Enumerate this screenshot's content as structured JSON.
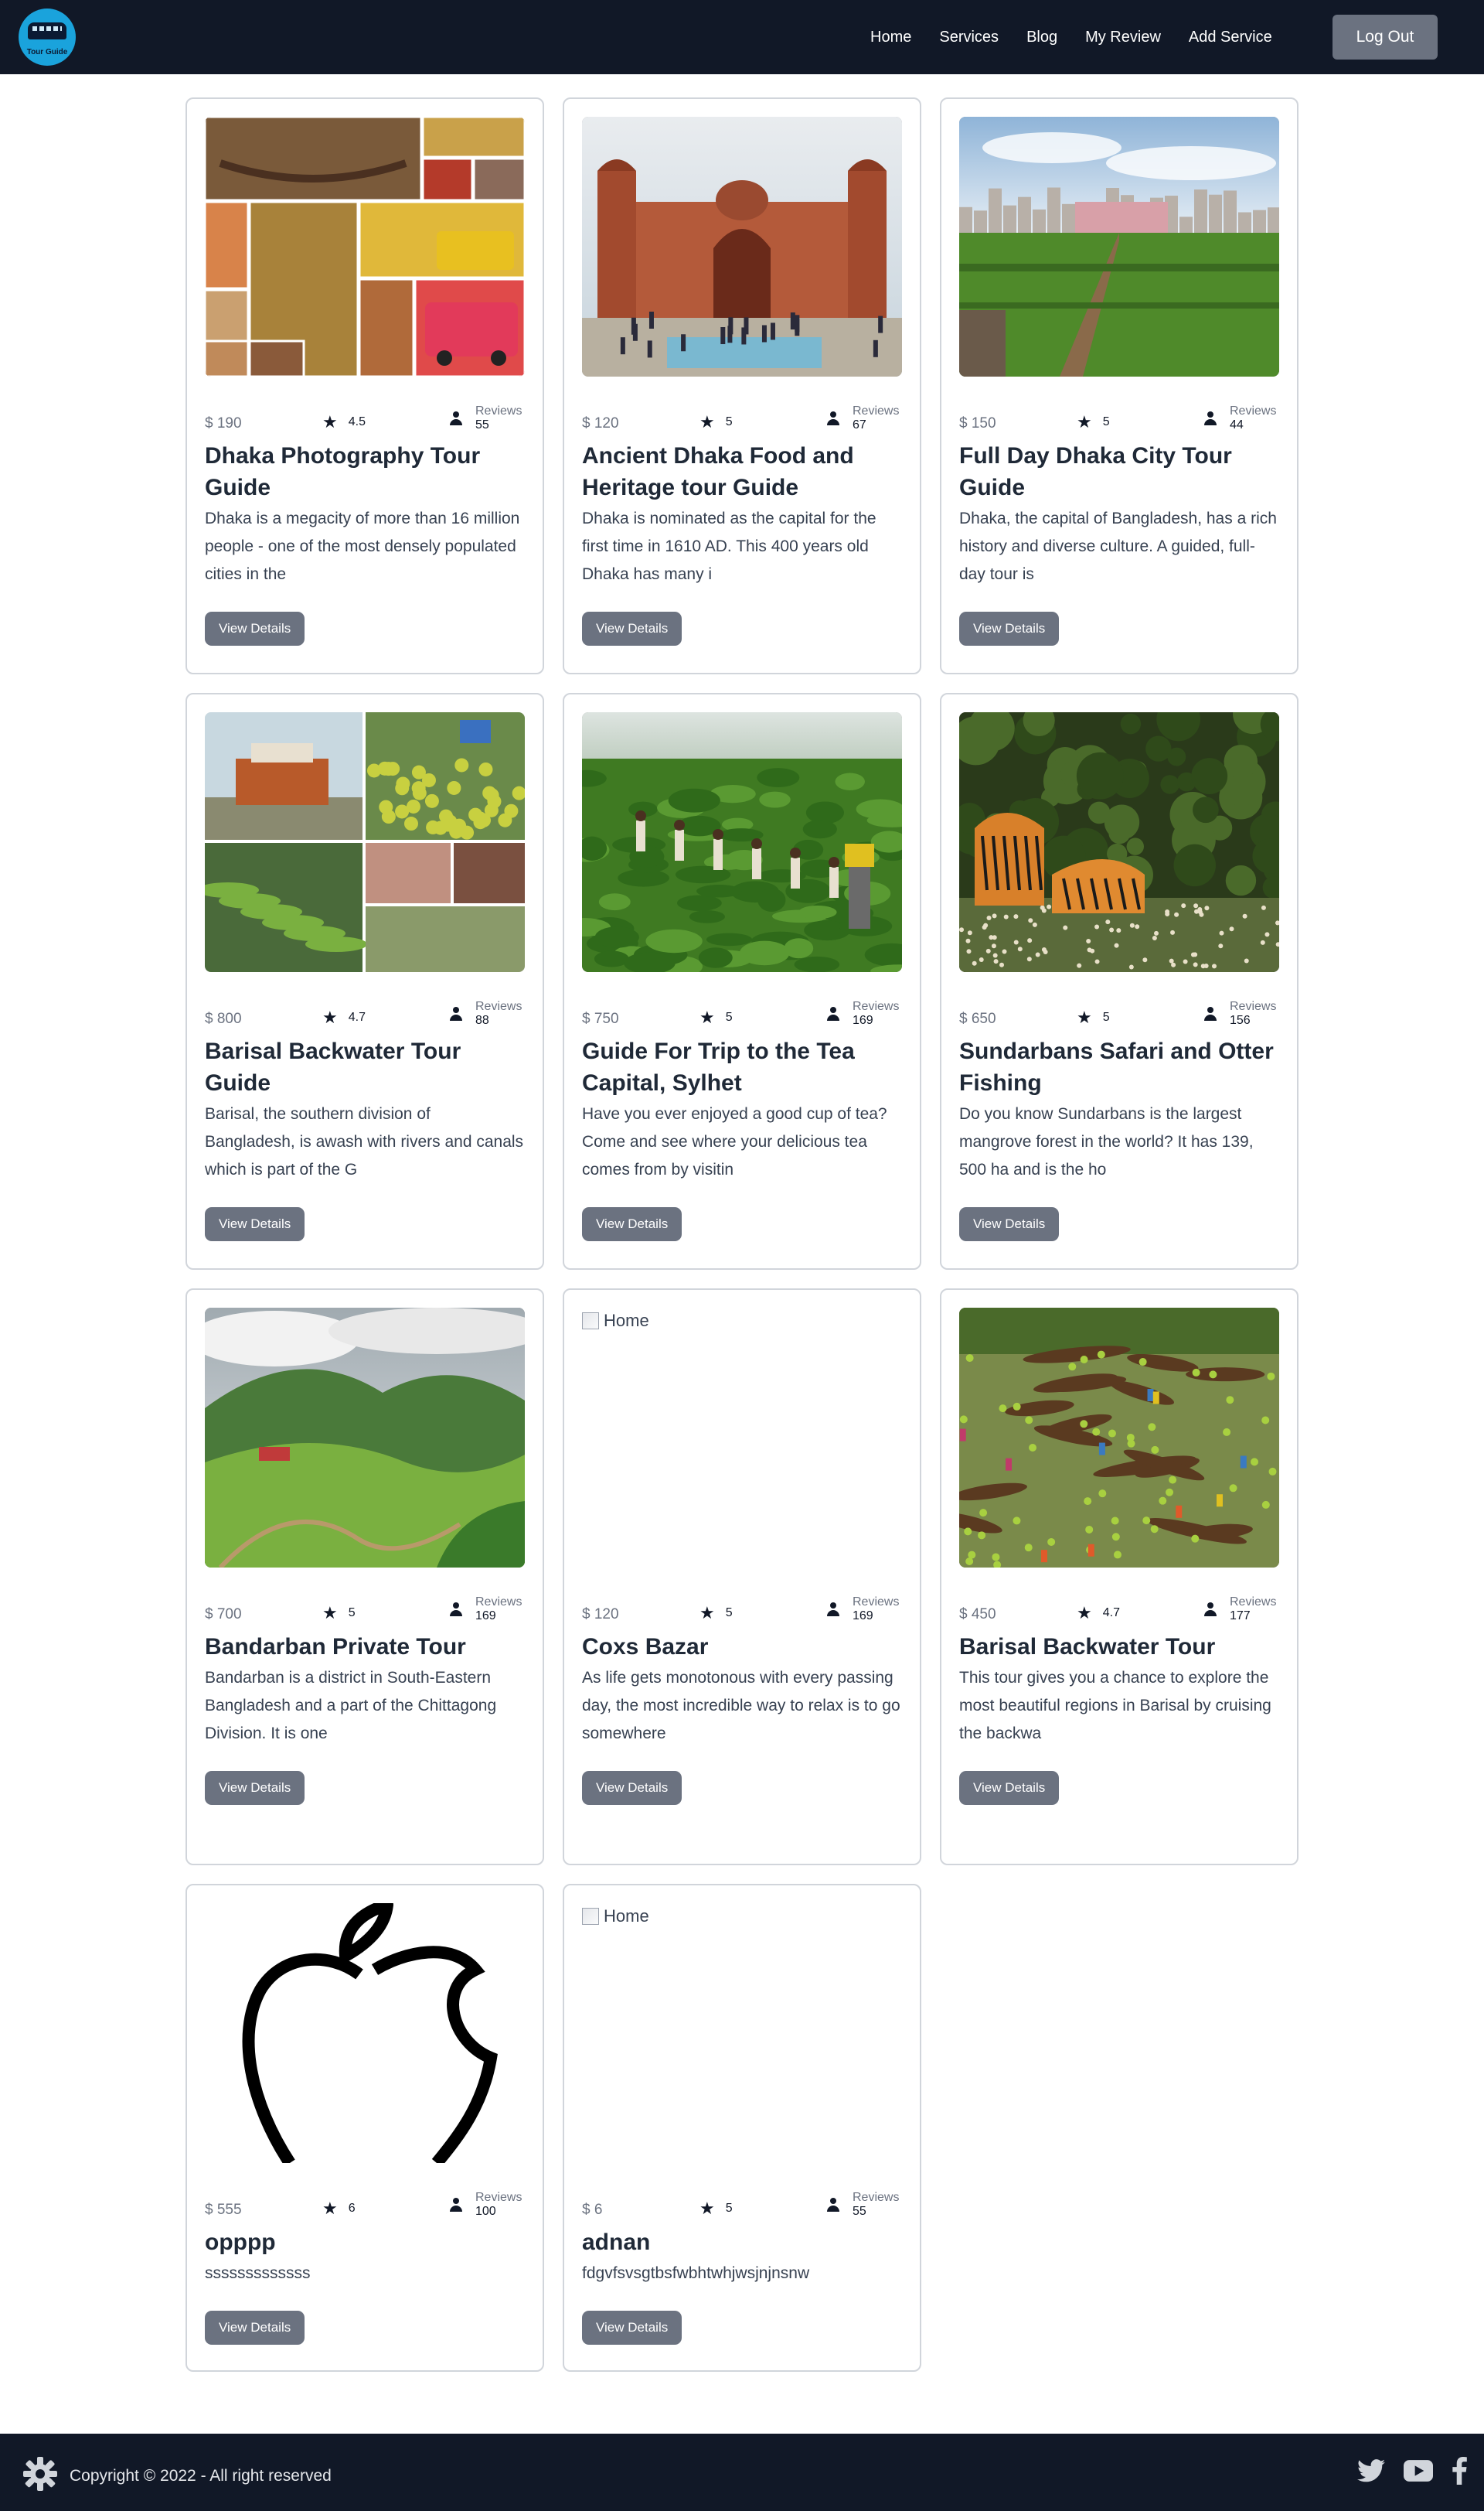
{
  "header": {
    "logo_text": "Tour Guide",
    "nav": [
      "Home",
      "Services",
      "Blog",
      "My Review",
      "Add Service"
    ],
    "logout_label": "Log Out"
  },
  "services": [
    {
      "price": "$ 190",
      "rating": "4.5",
      "reviews_label": "Reviews",
      "reviews": "55",
      "title": "Dhaka Photography Tour Guide",
      "description": "Dhaka is a megacity of more than 16 million people - one of the most densely populated cities in the",
      "button": "View Details",
      "image": "collage"
    },
    {
      "price": "$ 120",
      "rating": "5",
      "reviews_label": "Reviews",
      "reviews": "67",
      "title": "Ancient Dhaka Food and Heritage tour Guide",
      "description": "Dhaka is nominated as the capital for the first time in 1610 AD. This 400 years old Dhaka has many i",
      "button": "View Details",
      "image": "fort"
    },
    {
      "price": "$ 150",
      "rating": "5",
      "reviews_label": "Reviews",
      "reviews": "44",
      "title": "Full Day Dhaka City Tour Guide",
      "description": "Dhaka, the capital of Bangladesh, has a rich history and diverse culture. A guided, full-day tour is",
      "button": "View Details",
      "image": "garden"
    },
    {
      "price": "$ 800",
      "rating": "4.7",
      "reviews_label": "Reviews",
      "reviews": "88",
      "title": "Barisal Backwater Tour Guide",
      "description": "Barisal, the southern division of Bangladesh, is awash with rivers and canals which is part of the G",
      "button": "View Details",
      "image": "barisal-collage"
    },
    {
      "price": "$ 750",
      "rating": "5",
      "reviews_label": "Reviews",
      "reviews": "169",
      "title": "Guide For Trip to the Tea Capital, Sylhet",
      "description": "Have you ever enjoyed a good cup of tea? Come and see where your delicious tea comes from by visitin",
      "button": "View Details",
      "image": "tea"
    },
    {
      "price": "$ 650",
      "rating": "5",
      "reviews_label": "Reviews",
      "reviews": "156",
      "title": "Sundarbans Safari and Otter Fishing",
      "description": "Do you know Sundarbans is the largest mangrove forest in the world? It has 139, 500 ha and is the ho",
      "button": "View Details",
      "image": "tigers"
    },
    {
      "price": "$ 700",
      "rating": "5",
      "reviews_label": "Reviews",
      "reviews": "169",
      "title": "Bandarban Private Tour",
      "description": "Bandarban is a district in South-Eastern Bangladesh and a part of the Chittagong Division. It is one",
      "button": "View Details",
      "image": "hills"
    },
    {
      "price": "$ 120",
      "rating": "5",
      "reviews_label": "Reviews",
      "reviews": "169",
      "title": "Coxs Bazar",
      "description": "As life gets monotonous with every passing day, the most incredible way to relax is to go somewhere",
      "button": "View Details",
      "image": "broken",
      "alt": "Home"
    },
    {
      "price": "$ 450",
      "rating": "4.7",
      "reviews_label": "Reviews",
      "reviews": "177",
      "title": "Barisal Backwater Tour",
      "description": "This tour gives you a chance to explore the most beautiful regions in Barisal by cruising the backwa",
      "button": "View Details",
      "image": "boats"
    },
    {
      "price": "$ 555",
      "rating": "6",
      "reviews_label": "Reviews",
      "reviews": "100",
      "title": "opppp",
      "description": "sssssssssssss",
      "button": "View Details",
      "image": "apple"
    },
    {
      "price": "$ 6",
      "rating": "5",
      "reviews_label": "Reviews",
      "reviews": "55",
      "title": "adnan",
      "description": "fdgvfsvsgtbsfwbhtwhjwsjnjnsnw",
      "button": "View Details",
      "image": "broken",
      "alt": "Home"
    }
  ],
  "footer": {
    "copyright": "Copyright © 2022 - All right reserved",
    "social": [
      "twitter-icon",
      "youtube-icon",
      "facebook-icon"
    ]
  }
}
